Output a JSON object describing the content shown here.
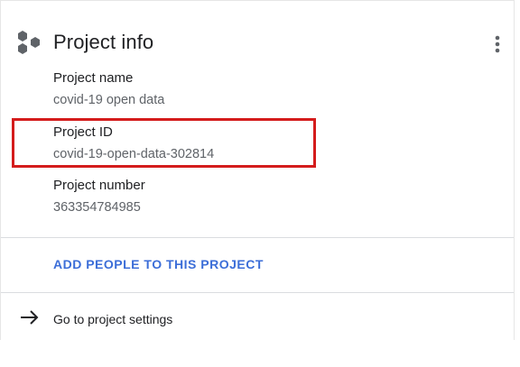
{
  "card": {
    "title": "Project info",
    "icon": "project-hexagons-icon",
    "menu_icon": "more-vert-icon"
  },
  "fields": [
    {
      "label": "Project name",
      "value": "covid-19 open data"
    },
    {
      "label": "Project ID",
      "value": "covid-19-open-data-302814"
    },
    {
      "label": "Project number",
      "value": "363354784985"
    }
  ],
  "actions": {
    "add_people": "ADD PEOPLE TO THIS PROJECT",
    "settings": "Go to project settings",
    "settings_icon": "arrow-right-icon"
  },
  "colors": {
    "highlight": "#d41c1c",
    "link": "#3c6ed8",
    "icon": "#5f6368"
  }
}
